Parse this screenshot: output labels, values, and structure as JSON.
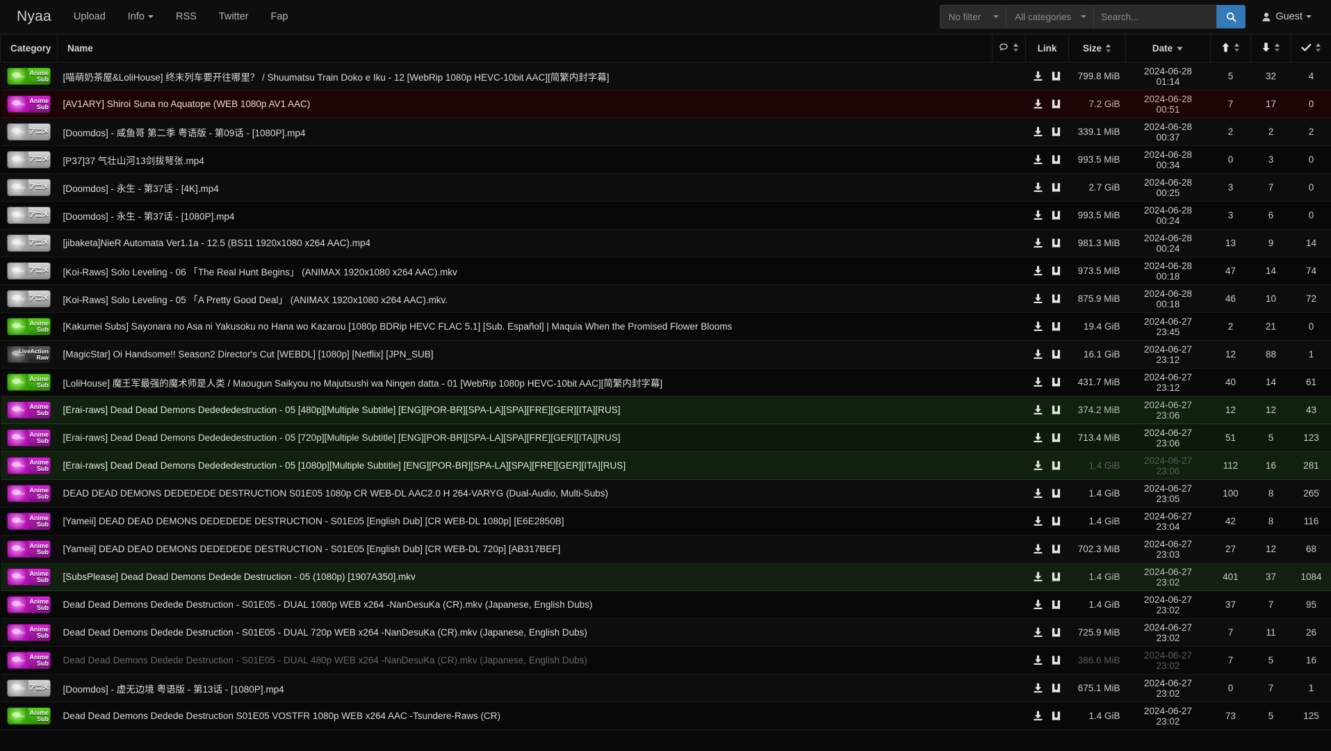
{
  "navbar": {
    "brand": "Nyaa",
    "links": [
      {
        "label": "Upload",
        "caret": false
      },
      {
        "label": "Info",
        "caret": true
      },
      {
        "label": "RSS",
        "caret": false
      },
      {
        "label": "Twitter",
        "caret": false
      },
      {
        "label": "Fap",
        "caret": false
      }
    ],
    "filter_select": "No filter",
    "category_select": "All categories",
    "search_placeholder": "Search...",
    "search_value": "",
    "search_icon": "search-icon",
    "user_label": "Guest",
    "accent_color": "#337ab7"
  },
  "table": {
    "headers": {
      "category": "Category",
      "name": "Name",
      "comments": "",
      "link": "Link",
      "size": "Size",
      "date": "Date",
      "seeders": "",
      "leechers": "",
      "completed": ""
    },
    "rows": [
      {
        "cat": "anime-sub-green",
        "cat_label": [
          "Anime",
          "Sub"
        ],
        "name": "[喵萌奶茶屋&LoliHouse] 终末列车要开往哪里？ / Shuumatsu Train Doko e Iku - 12 [WebRip 1080p HEVC-10bit AAC][简繁内封字幕]",
        "size": "799.8 MiB",
        "date": "2024-06-28 01:14",
        "s": "5",
        "l": "32",
        "d": "4",
        "style": "default",
        "dim": false
      },
      {
        "cat": "anime-sub-magenta",
        "cat_label": [
          "Anime",
          "Sub"
        ],
        "name": "[AV1ARY] Shiroi Suna no Aquatope (WEB 1080p AV1 AAC)",
        "size": "7.2 GiB",
        "date": "2024-06-28 00:51",
        "s": "7",
        "l": "17",
        "d": "0",
        "style": "danger",
        "dim": false
      },
      {
        "cat": "anime-raw",
        "cat_label": [
          "アニメ"
        ],
        "name": "[Doomdos] - 咸鱼哥 第二季 粤语版 - 第09话 - [1080P].mp4",
        "size": "339.1 MiB",
        "date": "2024-06-28 00:37",
        "s": "2",
        "l": "2",
        "d": "2",
        "style": "default",
        "dim": false
      },
      {
        "cat": "anime-raw",
        "cat_label": [
          "アニメ"
        ],
        "name": "[P37]37 气壮山河13剑拔弩张.mp4",
        "size": "993.5 MiB",
        "date": "2024-06-28 00:34",
        "s": "0",
        "l": "3",
        "d": "0",
        "style": "alt",
        "dim": false
      },
      {
        "cat": "anime-raw",
        "cat_label": [
          "アニメ"
        ],
        "name": "[Doomdos] - 永生 - 第37话 - [4K].mp4",
        "size": "2.7 GiB",
        "date": "2024-06-28 00:25",
        "s": "3",
        "l": "7",
        "d": "0",
        "style": "default",
        "dim": false
      },
      {
        "cat": "anime-raw",
        "cat_label": [
          "アニメ"
        ],
        "name": "[Doomdos] - 永生 - 第37话 - [1080P].mp4",
        "size": "993.5 MiB",
        "date": "2024-06-28 00:24",
        "s": "3",
        "l": "6",
        "d": "0",
        "style": "alt",
        "dim": false
      },
      {
        "cat": "anime-raw",
        "cat_label": [
          "アニメ"
        ],
        "name": "[jibaketa]NieR Automata Ver1.1a - 12.5 (BS11 1920x1080 x264 AAC).mp4",
        "size": "981.3 MiB",
        "date": "2024-06-28 00:24",
        "s": "13",
        "l": "9",
        "d": "14",
        "style": "default",
        "dim": false
      },
      {
        "cat": "anime-raw",
        "cat_label": [
          "アニメ"
        ],
        "name": "[Koi-Raws] Solo Leveling - 06 「The Real Hunt Begins」 (ANIMAX 1920x1080 x264 AAC).mkv",
        "size": "973.5 MiB",
        "date": "2024-06-28 00:18",
        "s": "47",
        "l": "14",
        "d": "74",
        "style": "alt",
        "dim": false
      },
      {
        "cat": "anime-raw",
        "cat_label": [
          "アニメ"
        ],
        "name": "[Koi-Raws] Solo Leveling - 05 「A Pretty Good Deal」 (ANIMAX 1920x1080 x264 AAC).mkv.",
        "size": "875.9 MiB",
        "date": "2024-06-28 00:18",
        "s": "46",
        "l": "10",
        "d": "72",
        "style": "default",
        "dim": false
      },
      {
        "cat": "anime-sub-green",
        "cat_label": [
          "Anime",
          "Sub"
        ],
        "name": "[Kakumei Subs] Sayonara no Asa ni Yakusoku no Hana wo Kazarou [1080p BDRip HEVC FLAC 5.1] [Sub. Español] | Maquia When the Promised Flower Blooms",
        "size": "19.4 GiB",
        "date": "2024-06-27 23:45",
        "s": "2",
        "l": "21",
        "d": "0",
        "style": "alt",
        "dim": false
      },
      {
        "cat": "live-raw",
        "cat_label": [
          "LiveAction",
          "Raw"
        ],
        "name": "[MagicStar] Oi Handsome!! Season2 Director's Cut [WEBDL] [1080p] [Netflix] [JPN_SUB]",
        "size": "16.1 GiB",
        "date": "2024-06-27 23:12",
        "s": "12",
        "l": "88",
        "d": "1",
        "style": "default",
        "dim": false
      },
      {
        "cat": "anime-sub-green",
        "cat_label": [
          "Anime",
          "Sub"
        ],
        "name": "[LoliHouse] 魔王军最强的魔术师是人类 / Maougun Saikyou no Majutsushi wa Ningen datta - 01 [WebRip 1080p HEVC-10bit AAC][简繁内封字幕]",
        "size": "431.7 MiB",
        "date": "2024-06-27 23:12",
        "s": "40",
        "l": "14",
        "d": "61",
        "style": "alt",
        "dim": false
      },
      {
        "cat": "anime-sub-magenta",
        "cat_label": [
          "Anime",
          "Sub"
        ],
        "name": "[Erai-raws] Dead Dead Demons Dedededestruction - 05 [480p][Multiple Subtitle] [ENG][POR-BR][SPA-LA][SPA][FRE][GER][ITA][RUS]",
        "size": "374.2 MiB",
        "date": "2024-06-27 23:06",
        "s": "12",
        "l": "12",
        "d": "43",
        "style": "success",
        "dim": false
      },
      {
        "cat": "anime-sub-magenta",
        "cat_label": [
          "Anime",
          "Sub"
        ],
        "name": "[Erai-raws] Dead Dead Demons Dedededestruction - 05 [720p][Multiple Subtitle] [ENG][POR-BR][SPA-LA][SPA][FRE][GER][ITA][RUS]",
        "size": "713.4 MiB",
        "date": "2024-06-27 23:06",
        "s": "51",
        "l": "5",
        "d": "123",
        "style": "success-alt",
        "dim": false
      },
      {
        "cat": "anime-sub-magenta",
        "cat_label": [
          "Anime",
          "Sub"
        ],
        "name": "[Erai-raws] Dead Dead Demons Dedededestruction - 05 [1080p][Multiple Subtitle] [ENG][POR-BR][SPA-LA][SPA][FRE][GER][ITA][RUS]",
        "size": "1.4 GiB",
        "date": "2024-06-27 23:06",
        "s": "112",
        "l": "16",
        "d": "281",
        "style": "success",
        "dim": true
      },
      {
        "cat": "anime-sub-magenta",
        "cat_label": [
          "Anime",
          "Sub"
        ],
        "name": "DEAD DEAD DEMONS DEDEDEDE DESTRUCTION S01E05 1080p CR WEB-DL AAC2.0 H 264-VARYG (Dual-Audio, Multi-Subs)",
        "size": "1.4 GiB",
        "date": "2024-06-27 23:05",
        "s": "100",
        "l": "8",
        "d": "265",
        "style": "default",
        "dim": false
      },
      {
        "cat": "anime-sub-magenta",
        "cat_label": [
          "Anime",
          "Sub"
        ],
        "name": "[Yameii] DEAD DEAD DEMONS DEDEDEDE DESTRUCTION - S01E05 [English Dub] [CR WEB-DL 1080p] [E6E2850B]",
        "size": "1.4 GiB",
        "date": "2024-06-27 23:04",
        "s": "42",
        "l": "8",
        "d": "116",
        "style": "alt",
        "dim": false
      },
      {
        "cat": "anime-sub-magenta",
        "cat_label": [
          "Anime",
          "Sub"
        ],
        "name": "[Yameii] DEAD DEAD DEMONS DEDEDEDE DESTRUCTION - S01E05 [English Dub] [CR WEB-DL 720p] [AB317BEF]",
        "size": "702.3 MiB",
        "date": "2024-06-27 23:03",
        "s": "27",
        "l": "12",
        "d": "68",
        "style": "default",
        "dim": false
      },
      {
        "cat": "anime-sub-magenta",
        "cat_label": [
          "Anime",
          "Sub"
        ],
        "name": "[SubsPlease] Dead Dead Demons Dedede Destruction - 05 (1080p) [1907A350].mkv",
        "size": "1.4 GiB",
        "date": "2024-06-27 23:02",
        "s": "401",
        "l": "37",
        "d": "1084",
        "style": "success",
        "dim": false
      },
      {
        "cat": "anime-sub-magenta",
        "cat_label": [
          "Anime",
          "Sub"
        ],
        "name": "Dead Dead Demons Dedede Destruction - S01E05 - DUAL 1080p WEB x264 -NanDesuKa (CR).mkv (Japanese, English Dubs)",
        "size": "1.4 GiB",
        "date": "2024-06-27 23:02",
        "s": "37",
        "l": "7",
        "d": "95",
        "style": "alt",
        "dim": false
      },
      {
        "cat": "anime-sub-magenta",
        "cat_label": [
          "Anime",
          "Sub"
        ],
        "name": "Dead Dead Demons Dedede Destruction - S01E05 - DUAL 720p WEB x264 -NanDesuKa (CR).mkv (Japanese, English Dubs)",
        "size": "725.9 MiB",
        "date": "2024-06-27 23:02",
        "s": "7",
        "l": "11",
        "d": "26",
        "style": "default",
        "dim": false
      },
      {
        "cat": "anime-sub-magenta",
        "cat_label": [
          "Anime",
          "Sub"
        ],
        "name": "Dead Dead Demons Dedede Destruction - S01E05 - DUAL 480p WEB x264 -NanDesuKa (CR).mkv (Japanese, English Dubs)",
        "size": "386.6 MiB",
        "date": "2024-06-27 23:02",
        "s": "7",
        "l": "5",
        "d": "16",
        "style": "alt",
        "dim": true
      },
      {
        "cat": "anime-raw",
        "cat_label": [
          "アニメ"
        ],
        "name": "[Doomdos] - 虚无边境 粤语版 - 第13话 - [1080P].mp4",
        "size": "675.1 MiB",
        "date": "2024-06-27 23:02",
        "s": "0",
        "l": "7",
        "d": "1",
        "style": "default",
        "dim": false
      },
      {
        "cat": "anime-sub-green",
        "cat_label": [
          "Anime",
          "Sub"
        ],
        "name": "Dead Dead Demons Dedede Destruction S01E05 VOSTFR 1080p WEB x264 AAC -Tsundere-Raws (CR)",
        "size": "1.4 GiB",
        "date": "2024-06-27 23:02",
        "s": "73",
        "l": "5",
        "d": "125",
        "style": "alt",
        "dim": false
      }
    ]
  }
}
